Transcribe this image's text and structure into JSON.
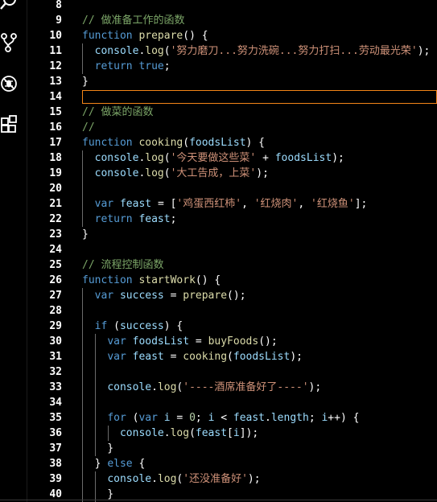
{
  "activity_bar": {
    "icons": [
      "search-icon",
      "source-control-icon",
      "debug-icon",
      "extensions-icon"
    ]
  },
  "editor": {
    "current_line": 14,
    "lines": [
      {
        "n": "8",
        "tokens": []
      },
      {
        "n": "9",
        "tokens": [
          [
            "c",
            "// 做准备工作的函数"
          ]
        ]
      },
      {
        "n": "10",
        "tokens": [
          [
            "k",
            "function "
          ],
          [
            "f",
            "prepare"
          ],
          [
            "p",
            "() {"
          ]
        ]
      },
      {
        "n": "11",
        "tokens": [
          [
            "p",
            "  "
          ],
          [
            "v",
            "console"
          ],
          [
            "p",
            "."
          ],
          [
            "f",
            "log"
          ],
          [
            "p",
            "("
          ],
          [
            "s",
            "'努力磨刀...努力洗碗...努力打扫...劳动最光荣'"
          ],
          [
            "p",
            ");"
          ]
        ]
      },
      {
        "n": "12",
        "tokens": [
          [
            "p",
            "  "
          ],
          [
            "k",
            "return "
          ],
          [
            "k",
            "true"
          ],
          [
            "p",
            ";"
          ]
        ]
      },
      {
        "n": "13",
        "tokens": [
          [
            "p",
            "}"
          ]
        ]
      },
      {
        "n": "14",
        "tokens": []
      },
      {
        "n": "15",
        "tokens": [
          [
            "c",
            "// 做菜的函数"
          ]
        ]
      },
      {
        "n": "16",
        "tokens": [
          [
            "c",
            "//"
          ]
        ]
      },
      {
        "n": "17",
        "tokens": [
          [
            "k",
            "function "
          ],
          [
            "f",
            "cooking"
          ],
          [
            "p",
            "("
          ],
          [
            "v",
            "foodsList"
          ],
          [
            "p",
            ") {"
          ]
        ]
      },
      {
        "n": "18",
        "tokens": [
          [
            "p",
            "  "
          ],
          [
            "v",
            "console"
          ],
          [
            "p",
            "."
          ],
          [
            "f",
            "log"
          ],
          [
            "p",
            "("
          ],
          [
            "s",
            "'今天要做这些菜' "
          ],
          [
            "p",
            "+ "
          ],
          [
            "v",
            "foodsList"
          ],
          [
            "p",
            ");"
          ]
        ]
      },
      {
        "n": "19",
        "tokens": [
          [
            "p",
            "  "
          ],
          [
            "v",
            "console"
          ],
          [
            "p",
            "."
          ],
          [
            "f",
            "log"
          ],
          [
            "p",
            "("
          ],
          [
            "s",
            "'大工告成，上菜'"
          ],
          [
            "p",
            ");"
          ]
        ]
      },
      {
        "n": "20",
        "tokens": []
      },
      {
        "n": "21",
        "tokens": [
          [
            "p",
            "  "
          ],
          [
            "k",
            "var "
          ],
          [
            "v",
            "feast "
          ],
          [
            "p",
            "= ["
          ],
          [
            "s",
            "'鸡蛋西红柿'"
          ],
          [
            "p",
            ", "
          ],
          [
            "s",
            "'红烧肉'"
          ],
          [
            "p",
            ", "
          ],
          [
            "s",
            "'红烧鱼'"
          ],
          [
            "p",
            "];"
          ]
        ]
      },
      {
        "n": "22",
        "tokens": [
          [
            "p",
            "  "
          ],
          [
            "k",
            "return "
          ],
          [
            "v",
            "feast"
          ],
          [
            "p",
            ";"
          ]
        ]
      },
      {
        "n": "23",
        "tokens": [
          [
            "p",
            "}"
          ]
        ]
      },
      {
        "n": "24",
        "tokens": []
      },
      {
        "n": "25",
        "tokens": [
          [
            "c",
            "// 流程控制函数"
          ]
        ]
      },
      {
        "n": "26",
        "tokens": [
          [
            "k",
            "function "
          ],
          [
            "f",
            "startWork"
          ],
          [
            "p",
            "() {"
          ]
        ]
      },
      {
        "n": "27",
        "tokens": [
          [
            "p",
            "  "
          ],
          [
            "k",
            "var "
          ],
          [
            "v",
            "success "
          ],
          [
            "p",
            "= "
          ],
          [
            "f",
            "prepare"
          ],
          [
            "p",
            "();"
          ]
        ]
      },
      {
        "n": "28",
        "tokens": []
      },
      {
        "n": "29",
        "tokens": [
          [
            "p",
            "  "
          ],
          [
            "k",
            "if "
          ],
          [
            "p",
            "("
          ],
          [
            "v",
            "success"
          ],
          [
            "p",
            ") {"
          ]
        ]
      },
      {
        "n": "30",
        "tokens": [
          [
            "p",
            "    "
          ],
          [
            "k",
            "var "
          ],
          [
            "v",
            "foodsList "
          ],
          [
            "p",
            "= "
          ],
          [
            "f",
            "buyFoods"
          ],
          [
            "p",
            "();"
          ]
        ]
      },
      {
        "n": "31",
        "tokens": [
          [
            "p",
            "    "
          ],
          [
            "k",
            "var "
          ],
          [
            "v",
            "feast "
          ],
          [
            "p",
            "= "
          ],
          [
            "f",
            "cooking"
          ],
          [
            "p",
            "("
          ],
          [
            "v",
            "foodsList"
          ],
          [
            "p",
            ");"
          ]
        ]
      },
      {
        "n": "32",
        "tokens": []
      },
      {
        "n": "33",
        "tokens": [
          [
            "p",
            "    "
          ],
          [
            "v",
            "console"
          ],
          [
            "p",
            "."
          ],
          [
            "f",
            "log"
          ],
          [
            "p",
            "("
          ],
          [
            "s",
            "'----酒席准备好了----'"
          ],
          [
            "p",
            ");"
          ]
        ]
      },
      {
        "n": "34",
        "tokens": []
      },
      {
        "n": "35",
        "tokens": [
          [
            "p",
            "    "
          ],
          [
            "k",
            "for "
          ],
          [
            "p",
            "("
          ],
          [
            "k",
            "var "
          ],
          [
            "v",
            "i "
          ],
          [
            "p",
            "= "
          ],
          [
            "n",
            "0"
          ],
          [
            "p",
            "; "
          ],
          [
            "v",
            "i "
          ],
          [
            "p",
            "< "
          ],
          [
            "v",
            "feast"
          ],
          [
            "p",
            "."
          ],
          [
            "v",
            "length"
          ],
          [
            "p",
            "; "
          ],
          [
            "v",
            "i"
          ],
          [
            "p",
            "++) {"
          ]
        ]
      },
      {
        "n": "36",
        "tokens": [
          [
            "p",
            "      "
          ],
          [
            "v",
            "console"
          ],
          [
            "p",
            "."
          ],
          [
            "f",
            "log"
          ],
          [
            "p",
            "("
          ],
          [
            "v",
            "feast"
          ],
          [
            "p",
            "["
          ],
          [
            "v",
            "i"
          ],
          [
            "p",
            "]);"
          ]
        ]
      },
      {
        "n": "37",
        "tokens": [
          [
            "p",
            "    }"
          ]
        ]
      },
      {
        "n": "38",
        "tokens": [
          [
            "p",
            "  } "
          ],
          [
            "k",
            "else "
          ],
          [
            "p",
            "{"
          ]
        ]
      },
      {
        "n": "39",
        "tokens": [
          [
            "p",
            "    "
          ],
          [
            "v",
            "console"
          ],
          [
            "p",
            "."
          ],
          [
            "f",
            "log"
          ],
          [
            "p",
            "("
          ],
          [
            "s",
            "'还没准备好'"
          ],
          [
            "p",
            ");"
          ]
        ]
      },
      {
        "n": "40",
        "tokens": [
          [
            "p",
            "    }"
          ]
        ]
      }
    ]
  }
}
